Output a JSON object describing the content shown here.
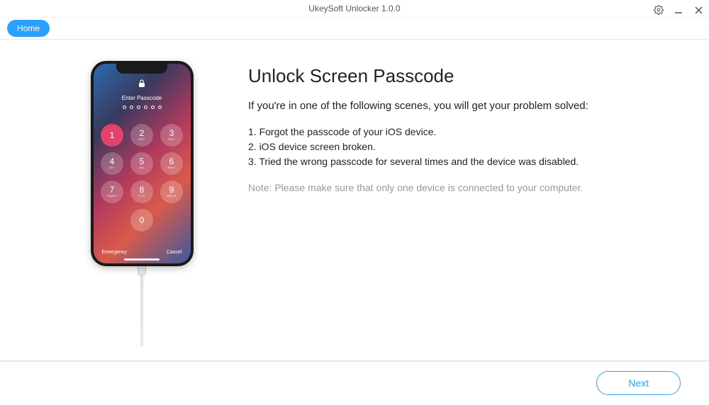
{
  "window": {
    "title": "UkeySoft Unlocker 1.0.0"
  },
  "topbar": {
    "home_label": "Home"
  },
  "main": {
    "heading": "Unlock Screen Passcode",
    "intro": "If you're in one of the following scenes, you will get your problem solved:",
    "scene1": "1. Forgot the passcode of your iOS device.",
    "scene2": "2. iOS device screen broken.",
    "scene3": "3. Tried the wrong passcode for several times and the device was disabled.",
    "note": "Note: Please make sure that only one device is connected to your computer."
  },
  "phone": {
    "prompt": "Enter Passcode",
    "emergency": "Emergency",
    "cancel": "Cancel",
    "keys": {
      "k1": "1",
      "k2": "2",
      "k3": "3",
      "k4": "4",
      "k5": "5",
      "k6": "6",
      "k7": "7",
      "k8": "8",
      "k9": "9",
      "k0": "0"
    },
    "subs": {
      "k2": "ABC",
      "k3": "DEF",
      "k4": "GHI",
      "k5": "JKL",
      "k6": "MNO",
      "k7": "PQRS",
      "k8": "TUV",
      "k9": "WXYZ"
    }
  },
  "footer": {
    "next_label": "Next"
  }
}
